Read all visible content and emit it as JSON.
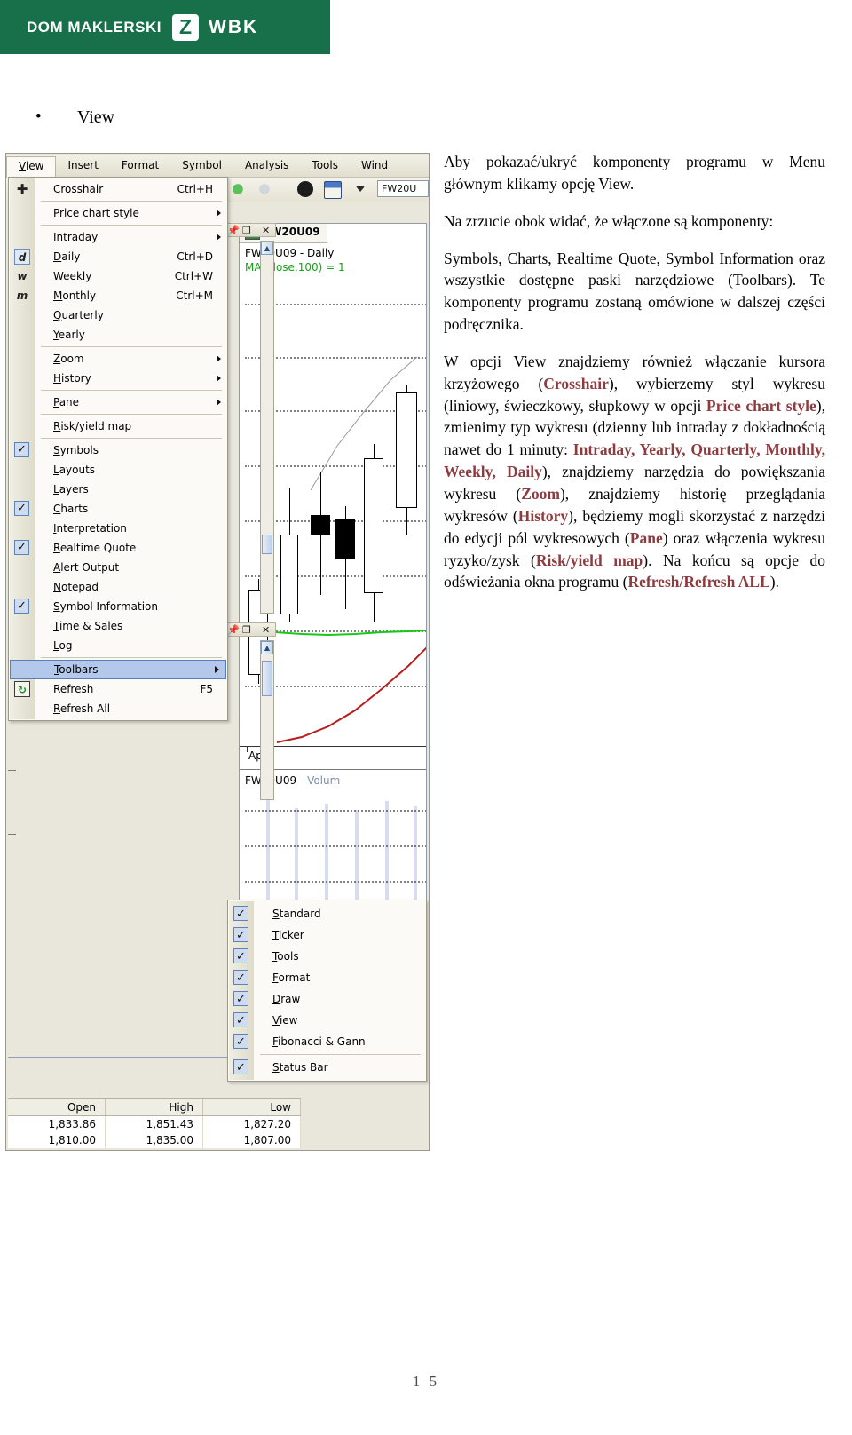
{
  "brand": {
    "name": "DOM MAKLERSKI",
    "logo_letter": "Z",
    "short_name": "WBK",
    "color": "#17704a"
  },
  "heading": {
    "bullet": "•",
    "label": "View"
  },
  "screenshot": {
    "menu_bar": [
      {
        "label": "View",
        "mnemonic": "V",
        "active": true
      },
      {
        "label": "Insert",
        "mnemonic": "I",
        "active": false
      },
      {
        "label": "Format",
        "mnemonic": "o",
        "active": false
      },
      {
        "label": "Symbol",
        "mnemonic": "S",
        "active": false
      },
      {
        "label": "Analysis",
        "mnemonic": "A",
        "active": false
      },
      {
        "label": "Tools",
        "mnemonic": "T",
        "active": false
      },
      {
        "label": "Wind",
        "mnemonic": "W",
        "active": false
      }
    ],
    "view_menu": [
      {
        "label": "Crosshair",
        "accel": "Ctrl+H",
        "icon": "crosshair-icon",
        "checked": false,
        "submenu": false
      },
      {
        "sep": true
      },
      {
        "label": "Price chart style",
        "accel": "",
        "icon": "",
        "checked": false,
        "submenu": true
      },
      {
        "sep": true
      },
      {
        "label": "Intraday",
        "accel": "",
        "icon": "",
        "checked": false,
        "submenu": true
      },
      {
        "label": "Daily",
        "accel": "Ctrl+D",
        "icon": "d",
        "checked": false,
        "submenu": false
      },
      {
        "label": "Weekly",
        "accel": "Ctrl+W",
        "icon": "w",
        "checked": false,
        "submenu": false
      },
      {
        "label": "Monthly",
        "accel": "Ctrl+M",
        "icon": "m",
        "checked": false,
        "submenu": false
      },
      {
        "label": "Quarterly",
        "accel": "",
        "icon": "",
        "checked": false,
        "submenu": false
      },
      {
        "label": "Yearly",
        "accel": "",
        "icon": "",
        "checked": false,
        "submenu": false
      },
      {
        "sep": true
      },
      {
        "label": "Zoom",
        "accel": "",
        "icon": "",
        "checked": false,
        "submenu": true
      },
      {
        "label": "History",
        "accel": "",
        "icon": "",
        "checked": false,
        "submenu": true
      },
      {
        "sep": true
      },
      {
        "label": "Pane",
        "accel": "",
        "icon": "",
        "checked": false,
        "submenu": true
      },
      {
        "sep": true
      },
      {
        "label": "Risk/yield map",
        "accel": "",
        "icon": "",
        "checked": false,
        "submenu": false
      },
      {
        "sep": true
      },
      {
        "label": "Symbols",
        "accel": "",
        "icon": "",
        "checked": true,
        "submenu": false
      },
      {
        "label": "Layouts",
        "accel": "",
        "icon": "",
        "checked": false,
        "submenu": false
      },
      {
        "label": "Layers",
        "accel": "",
        "icon": "",
        "checked": false,
        "submenu": false
      },
      {
        "label": "Charts",
        "accel": "",
        "icon": "",
        "checked": true,
        "submenu": false
      },
      {
        "label": "Interpretation",
        "accel": "",
        "icon": "",
        "checked": false,
        "submenu": false
      },
      {
        "label": "Realtime Quote",
        "accel": "",
        "icon": "",
        "checked": true,
        "submenu": false
      },
      {
        "label": "Alert Output",
        "accel": "",
        "icon": "",
        "checked": false,
        "submenu": false
      },
      {
        "label": "Notepad",
        "accel": "",
        "icon": "",
        "checked": false,
        "submenu": false
      },
      {
        "label": "Symbol Information",
        "accel": "",
        "icon": "",
        "checked": true,
        "submenu": false
      },
      {
        "label": "Time & Sales",
        "accel": "",
        "icon": "",
        "checked": false,
        "submenu": false
      },
      {
        "label": "Log",
        "accel": "",
        "icon": "",
        "checked": false,
        "submenu": false
      },
      {
        "sep": true
      },
      {
        "label": "Toolbars",
        "accel": "",
        "icon": "",
        "checked": false,
        "submenu": true,
        "highlight": true
      },
      {
        "label": "Refresh",
        "accel": "F5",
        "icon": "refresh-icon",
        "checked": false,
        "submenu": false
      },
      {
        "label": "Refresh All",
        "accel": "",
        "icon": "",
        "checked": false,
        "submenu": false
      }
    ],
    "toolbars_submenu": [
      {
        "label": "Standard",
        "checked": true
      },
      {
        "label": "Ticker",
        "checked": true
      },
      {
        "label": "Tools",
        "checked": true
      },
      {
        "label": "Format",
        "checked": true
      },
      {
        "label": "Draw",
        "checked": true
      },
      {
        "label": "View",
        "checked": true
      },
      {
        "label": "Fibonacci & Gann",
        "checked": true
      },
      {
        "sep": true
      },
      {
        "label": "Status Bar",
        "checked": true
      }
    ],
    "chart": {
      "tab_label": "FW20U09",
      "title": "FW20U09 - Daily",
      "indicator": "MA(Close,100) = 1",
      "axis_label": "April",
      "volume_symbol": "FW20U09 - ",
      "volume_word": "Volum"
    },
    "quotes": {
      "columns": [
        "Open",
        "High",
        "Low"
      ],
      "rows": [
        [
          "1,833.86",
          "1,851.43",
          "1,827.20"
        ],
        [
          "1,810.00",
          "1,835.00",
          "1,807.00"
        ]
      ]
    }
  },
  "body_text": {
    "p1_a": "Aby pokazać/ukryć komponenty programu w Menu głównym klikamy opcję View.",
    "p2_a": "Na zrzucie obok widać, że włączone są komponenty:",
    "p3_a": "Symbols, Charts, Realtime Quote, Symbol Information oraz wszystkie dostępne paski narzędziowe (Toolbars). Te komponenty programu zostaną omówione w dalszej części podręcznika.",
    "p4_s1": "W opcji View znajdziemy również włączanie kursora krzyżowego (",
    "p4_kw1": "Crosshair",
    "p4_s2": "), wybierzemy styl wykresu (liniowy, świeczkowy, słupkowy w opcji ",
    "p4_kw2": "Price chart style",
    "p4_s3": "), zmienimy typ wykresu (dzienny lub intraday z dokładnością nawet do 1 minuty: ",
    "p4_kw3": "Intraday, Yearly, Quarterly, Monthly, Weekly, Daily",
    "p4_s4": "), znajdziemy narzędzia do powiększania wykresu (",
    "p4_kw4": "Zoom",
    "p4_s5": "), znajdziemy historię przeglądania wykresów (",
    "p4_kw5": "History",
    "p4_s6": "), będziemy mogli skorzystać z narzędzi do edycji pól wykresowych (",
    "p4_kw6": "Pane",
    "p4_s7": ") oraz włączenia wykresu ryzyko/zysk (",
    "p4_kw7": "Risk/yield map",
    "p4_s8": "). Na końcu są opcje do odświeżania okna programu (",
    "p4_kw8": "Refresh/Refresh ALL",
    "p4_s9": ")."
  },
  "footer": {
    "page_number": "1 5"
  },
  "chart_data": {
    "type": "candlestick",
    "title": "FW20U09 - Daily",
    "indicator": "MA(Close,100)",
    "xlabel": "April",
    "candles": [
      {
        "open": 36,
        "close": 70,
        "high": 36,
        "low": 78,
        "dir": "up"
      },
      {
        "open": 30,
        "close": 62,
        "high": 14,
        "low": 66,
        "dir": "up"
      },
      {
        "open": 40,
        "close": 48,
        "high": 24,
        "low": 64,
        "dir": "down"
      },
      {
        "open": 46,
        "close": 58,
        "high": 44,
        "low": 64,
        "dir": "down"
      },
      {
        "open": 22,
        "close": 60,
        "high": 18,
        "low": 66,
        "dir": "up"
      },
      {
        "open": 8,
        "close": 30,
        "high": 4,
        "low": 40,
        "dir": "up"
      }
    ]
  }
}
